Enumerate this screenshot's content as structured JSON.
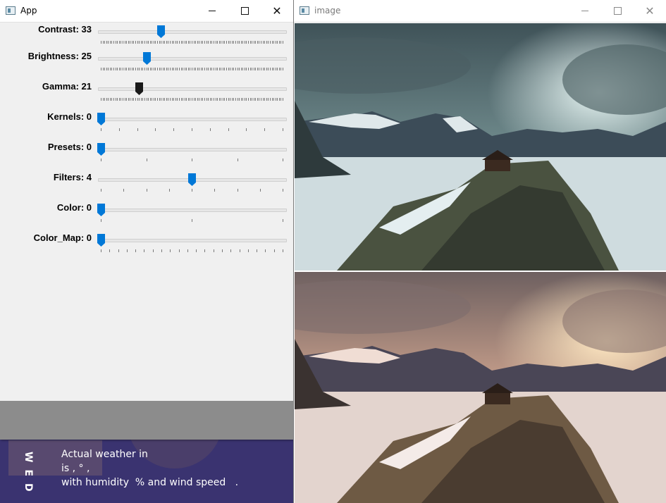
{
  "app_window": {
    "title": "App",
    "sliders": [
      {
        "label": "Contrast: 33",
        "value": 33,
        "max": 100
      },
      {
        "label": "Brightness: 25",
        "value": 25,
        "max": 100
      },
      {
        "label": "Gamma: 21",
        "value": 21,
        "max": 100,
        "focused": true
      },
      {
        "label": "Kernels: 0",
        "value": 0,
        "max": 10
      },
      {
        "label": "Presets: 0",
        "value": 0,
        "max": 4
      },
      {
        "label": "Filters: 4",
        "value": 4,
        "max": 8
      },
      {
        "label": "Color: 0",
        "value": 0,
        "max": 2
      },
      {
        "label": "Color_Map: 0",
        "value": 0,
        "max": 21
      }
    ]
  },
  "image_window": {
    "title": "image",
    "panels": [
      "processed-image",
      "original-image"
    ]
  },
  "background_widget": {
    "vertical_text": "WED",
    "line1": "Actual weather in",
    "line2": "is , ° ,",
    "line3": "with humidity  % and wind speed   ."
  },
  "colors": {
    "thumb_blue": "#0078d7",
    "thumb_focused": "#1a1a1a",
    "bg_purple": "#3a3370"
  }
}
